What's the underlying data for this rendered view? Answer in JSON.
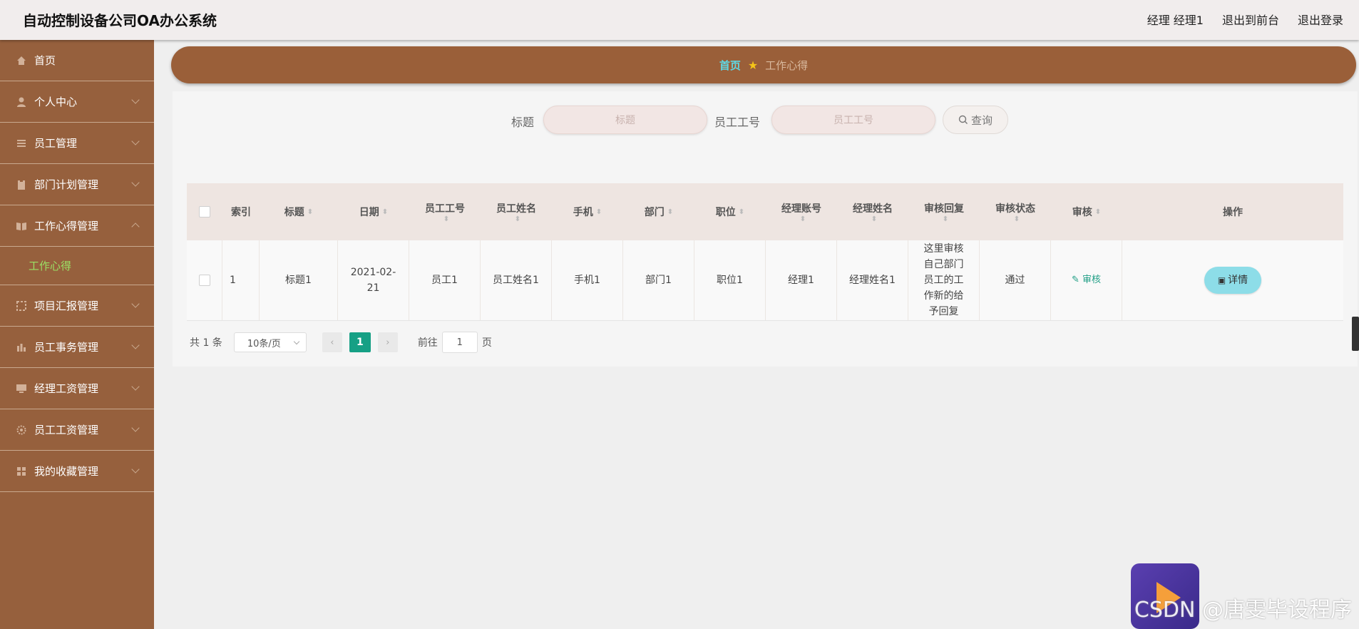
{
  "header": {
    "title": "自动控制设备公司OA办公系统",
    "user": "经理 经理1",
    "to_frontend": "退出到前台",
    "logout": "退出登录"
  },
  "sidebar": {
    "items": [
      {
        "label": "首页",
        "icon": "home-icon"
      },
      {
        "label": "个人中心",
        "icon": "user-icon"
      },
      {
        "label": "员工管理",
        "icon": "list-icon"
      },
      {
        "label": "部门计划管理",
        "icon": "clipboard-icon"
      },
      {
        "label": "工作心得管理",
        "icon": "book-icon"
      },
      {
        "label": "项目汇报管理",
        "icon": "frame-icon"
      },
      {
        "label": "员工事务管理",
        "icon": "chart-icon"
      },
      {
        "label": "经理工资管理",
        "icon": "monitor-icon"
      },
      {
        "label": "员工工资管理",
        "icon": "gear-icon"
      },
      {
        "label": "我的收藏管理",
        "icon": "grid-icon"
      }
    ],
    "sub_active": "工作心得"
  },
  "breadcrumb": {
    "home": "首页",
    "current": "工作心得"
  },
  "search": {
    "title_label": "标题",
    "title_placeholder": "标题",
    "emp_label": "员工工号",
    "emp_placeholder": "员工工号",
    "query_button": "查询"
  },
  "table": {
    "headers": [
      "索引",
      "标题",
      "日期",
      "员工工号",
      "员工姓名",
      "手机",
      "部门",
      "职位",
      "经理账号",
      "经理姓名",
      "审核回复",
      "审核状态",
      "审核",
      "操作"
    ],
    "rows": [
      {
        "index": "1",
        "title": "标题1",
        "date": "2021-02-21",
        "emp_no": "员工1",
        "emp_name": "员工姓名1",
        "phone": "手机1",
        "dept": "部门1",
        "position": "职位1",
        "mgr_account": "经理1",
        "mgr_name": "经理姓名1",
        "reply": "这里审核自己部门员工的工作新的给予回复",
        "status": "通过",
        "audit": "审核",
        "detail": "详情"
      }
    ]
  },
  "pagination": {
    "total": "共 1 条",
    "page_size": "10条/页",
    "current": "1",
    "goto_label": "前往",
    "goto_value": "1",
    "page_suffix": "页"
  },
  "watermark": "CSDN @唐雯毕设程序"
}
